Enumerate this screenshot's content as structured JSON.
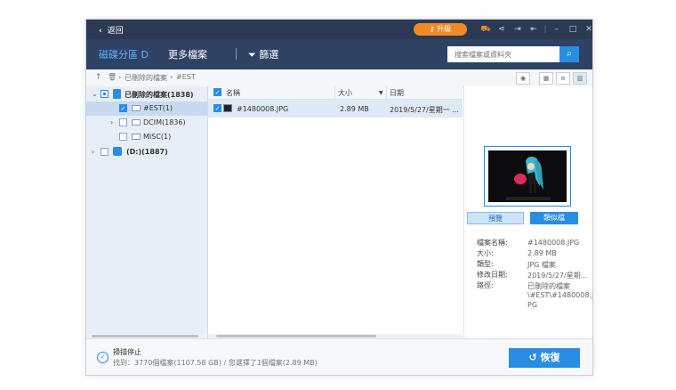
{
  "titlebar": {
    "back_label": "返回",
    "upgrade_label": "升級",
    "icons": [
      "cart-icon",
      "share-icon",
      "login-icon",
      "export-icon",
      "minimize-icon",
      "maximize-icon",
      "close-icon"
    ]
  },
  "nav": {
    "tab_disk": "磁碟分區 D",
    "tab_more": "更多檔案",
    "filter_label": "篩選",
    "search_placeholder": "搜索檔案或資料夾"
  },
  "breadcrumb": {
    "path_1": "已刪除的檔案",
    "path_2": "#EST"
  },
  "tree": {
    "root_label": "已刪除的檔案(1838)",
    "items": [
      {
        "label": "#EST(1)"
      },
      {
        "label": "DCIM(1836)"
      },
      {
        "label": "MISC(1)"
      }
    ],
    "drive_label": "(D:)(1887)"
  },
  "list": {
    "col_name": "名稱",
    "col_size": "大小",
    "col_date": "日期",
    "rows": [
      {
        "name": "#1480008.JPG",
        "size": "2.89 MB",
        "date": "2019/5/27/星期一 ..."
      }
    ]
  },
  "preview": {
    "btn_preview": "預覽",
    "btn_similar": "類似檔",
    "labels": {
      "name": "檔案名稱:",
      "size": "大小:",
      "type": "類型:",
      "modified": "修改日期:",
      "path": "路徑:"
    },
    "values": {
      "name": "#1480008.JPG",
      "size": "2.89 MB",
      "type": "JPG 檔案",
      "modified": "2019/5/27/星期...",
      "path_1": "已刪除的檔案",
      "path_2": "\\#EST\\#1480008.J",
      "path_3": "PG"
    }
  },
  "footer": {
    "status_title": "掃描停止",
    "status_detail": "找到：3770個檔案(1107.58 GB) / 您選擇了1個檔案(2.89 MB)",
    "recover_label": "恢復"
  },
  "colors": {
    "accent": "#2a8de4",
    "titlebar": "#2b3a52",
    "navbar": "#2f4263",
    "upgrade": "#f08a24"
  }
}
